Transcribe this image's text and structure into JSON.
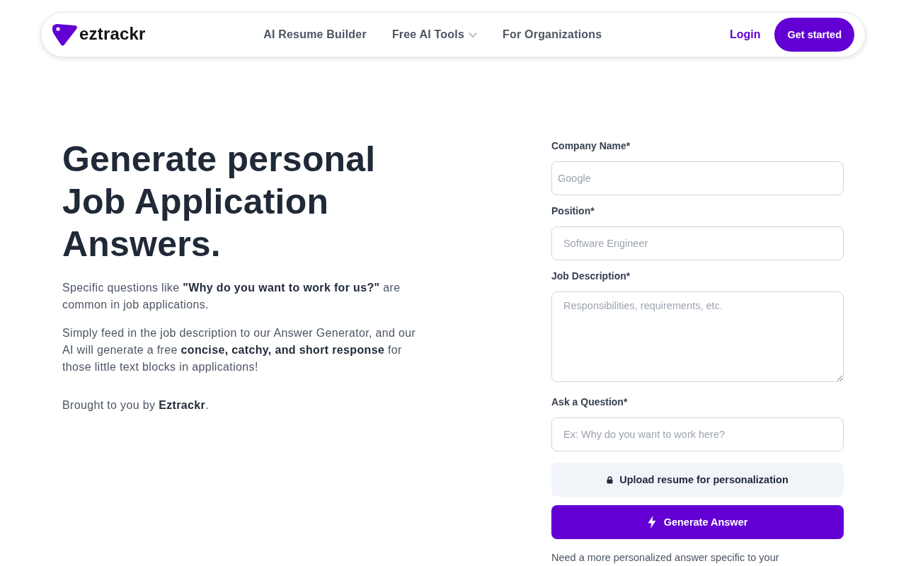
{
  "header": {
    "logo_text": "eztrackr",
    "nav": [
      {
        "label": "AI Resume Builder",
        "dropdown": false
      },
      {
        "label": "Free AI Tools",
        "dropdown": true
      },
      {
        "label": "For Organizations",
        "dropdown": false
      }
    ],
    "login": "Login",
    "cta": "Get started"
  },
  "hero": {
    "title": "Generate personal Job Application Answers.",
    "paragraphs": [
      "Specific questions like **\"Why do you want to work for us?\"** are common in job applications.",
      "Simply feed in the job description to our Answer Generator, and our AI will generate a free **concise, catchy, and short response** for those little text blocks in applications!"
    ],
    "credit": "Brought to you by **Eztrackr**."
  },
  "form": {
    "fields": [
      {
        "label": "Company Name*",
        "kind": "input",
        "placeholder": "Google"
      },
      {
        "label": "Position*",
        "kind": "input",
        "placeholder": "Software Engineer"
      },
      {
        "label": "Job Description*",
        "kind": "textarea",
        "placeholder": "Responsibilities, requirements, etc."
      },
      {
        "label": "Ask a Question*",
        "kind": "input",
        "placeholder": "Ex: Why do you want to work here?"
      }
    ],
    "upload_button": "Upload resume for personalization",
    "generate_button": "Generate Answer",
    "note": "Need a more personalized answer specific to your"
  }
}
